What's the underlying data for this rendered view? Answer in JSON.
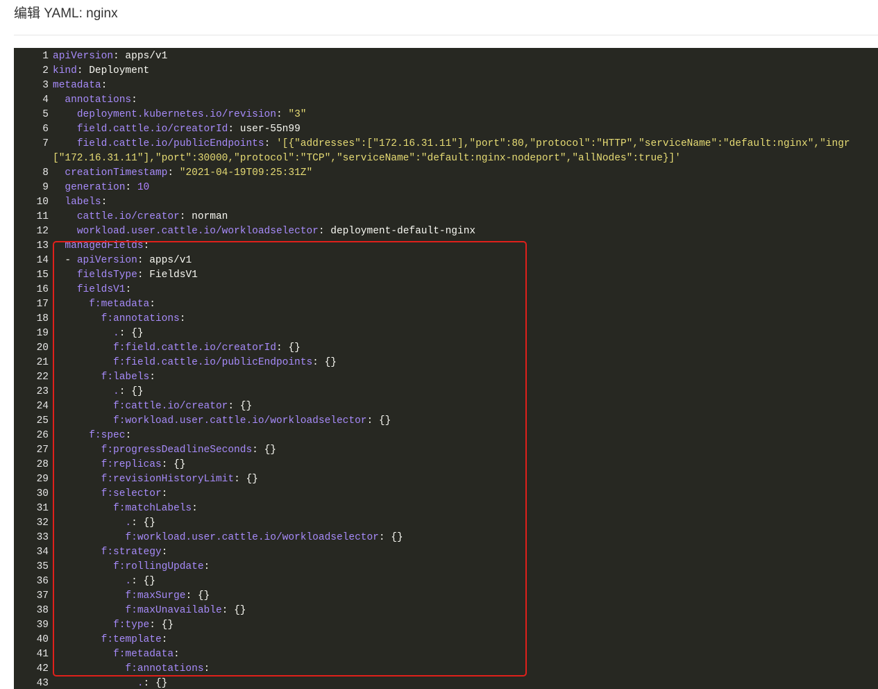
{
  "header": {
    "title": "编辑 YAML: nginx"
  },
  "colors": {
    "editor_bg": "#272822",
    "key": "#a78bfa",
    "string": "#e6db74",
    "highlight_border": "#e0201b"
  },
  "editor": {
    "lines": [
      {
        "n": "1",
        "segs": [
          [
            "k",
            "apiVersion"
          ],
          [
            "p",
            ": "
          ],
          [
            "v",
            "apps/v1"
          ]
        ]
      },
      {
        "n": "2",
        "segs": [
          [
            "k",
            "kind"
          ],
          [
            "p",
            ": "
          ],
          [
            "v",
            "Deployment"
          ]
        ]
      },
      {
        "n": "3",
        "segs": [
          [
            "k",
            "metadata"
          ],
          [
            "p",
            ":"
          ]
        ]
      },
      {
        "n": "4",
        "segs": [
          [
            "v",
            "  "
          ],
          [
            "k",
            "annotations"
          ],
          [
            "p",
            ":"
          ]
        ]
      },
      {
        "n": "5",
        "segs": [
          [
            "v",
            "    "
          ],
          [
            "k",
            "deployment.kubernetes.io/revision"
          ],
          [
            "p",
            ": "
          ],
          [
            "s",
            "\"3\""
          ]
        ]
      },
      {
        "n": "6",
        "segs": [
          [
            "v",
            "    "
          ],
          [
            "k",
            "field.cattle.io/creatorId"
          ],
          [
            "p",
            ": "
          ],
          [
            "v",
            "user-55n99"
          ]
        ]
      },
      {
        "n": "7",
        "segs": [
          [
            "v",
            "    "
          ],
          [
            "k",
            "field.cattle.io/publicEndpoints"
          ],
          [
            "p",
            ": "
          ],
          [
            "s",
            "'[{\"addresses\":[\"172.16.31.11\"],\"port\":80,\"protocol\":\"HTTP\",\"serviceName\":\"default:nginx\",\"ingr"
          ]
        ]
      },
      {
        "n": "",
        "segs": [
          [
            "s",
            "[\"172.16.31.11\"],\"port\":30000,\"protocol\":\"TCP\",\"serviceName\":\"default:nginx-nodeport\",\"allNodes\":true}]'"
          ]
        ]
      },
      {
        "n": "8",
        "segs": [
          [
            "v",
            "  "
          ],
          [
            "k",
            "creationTimestamp"
          ],
          [
            "p",
            ": "
          ],
          [
            "s",
            "\"2021-04-19T09:25:31Z\""
          ]
        ]
      },
      {
        "n": "9",
        "segs": [
          [
            "v",
            "  "
          ],
          [
            "k",
            "generation"
          ],
          [
            "p",
            ": "
          ],
          [
            "n",
            "10"
          ]
        ]
      },
      {
        "n": "10",
        "segs": [
          [
            "v",
            "  "
          ],
          [
            "k",
            "labels"
          ],
          [
            "p",
            ":"
          ]
        ]
      },
      {
        "n": "11",
        "segs": [
          [
            "v",
            "    "
          ],
          [
            "k",
            "cattle.io/creator"
          ],
          [
            "p",
            ": "
          ],
          [
            "v",
            "norman"
          ]
        ]
      },
      {
        "n": "12",
        "segs": [
          [
            "v",
            "    "
          ],
          [
            "k",
            "workload.user.cattle.io/workloadselector"
          ],
          [
            "p",
            ": "
          ],
          [
            "v",
            "deployment-default-nginx"
          ]
        ]
      },
      {
        "n": "13",
        "segs": [
          [
            "v",
            "  "
          ],
          [
            "k",
            "managedFields"
          ],
          [
            "p",
            ":"
          ]
        ]
      },
      {
        "n": "14",
        "segs": [
          [
            "v",
            "  - "
          ],
          [
            "k",
            "apiVersion"
          ],
          [
            "p",
            ": "
          ],
          [
            "v",
            "apps/v1"
          ]
        ]
      },
      {
        "n": "15",
        "segs": [
          [
            "v",
            "    "
          ],
          [
            "k",
            "fieldsType"
          ],
          [
            "p",
            ": "
          ],
          [
            "v",
            "FieldsV1"
          ]
        ]
      },
      {
        "n": "16",
        "segs": [
          [
            "v",
            "    "
          ],
          [
            "k",
            "fieldsV1"
          ],
          [
            "p",
            ":"
          ]
        ]
      },
      {
        "n": "17",
        "segs": [
          [
            "v",
            "      "
          ],
          [
            "k",
            "f:metadata"
          ],
          [
            "p",
            ":"
          ]
        ]
      },
      {
        "n": "18",
        "segs": [
          [
            "v",
            "        "
          ],
          [
            "k",
            "f:annotations"
          ],
          [
            "p",
            ":"
          ]
        ]
      },
      {
        "n": "19",
        "segs": [
          [
            "v",
            "          "
          ],
          [
            "k",
            "."
          ],
          [
            "p",
            ": "
          ],
          [
            "v",
            "{}"
          ]
        ]
      },
      {
        "n": "20",
        "segs": [
          [
            "v",
            "          "
          ],
          [
            "k",
            "f:field.cattle.io/creatorId"
          ],
          [
            "p",
            ": "
          ],
          [
            "v",
            "{}"
          ]
        ]
      },
      {
        "n": "21",
        "segs": [
          [
            "v",
            "          "
          ],
          [
            "k",
            "f:field.cattle.io/publicEndpoints"
          ],
          [
            "p",
            ": "
          ],
          [
            "v",
            "{}"
          ]
        ]
      },
      {
        "n": "22",
        "segs": [
          [
            "v",
            "        "
          ],
          [
            "k",
            "f:labels"
          ],
          [
            "p",
            ":"
          ]
        ]
      },
      {
        "n": "23",
        "segs": [
          [
            "v",
            "          "
          ],
          [
            "k",
            "."
          ],
          [
            "p",
            ": "
          ],
          [
            "v",
            "{}"
          ]
        ]
      },
      {
        "n": "24",
        "segs": [
          [
            "v",
            "          "
          ],
          [
            "k",
            "f:cattle.io/creator"
          ],
          [
            "p",
            ": "
          ],
          [
            "v",
            "{}"
          ]
        ]
      },
      {
        "n": "25",
        "segs": [
          [
            "v",
            "          "
          ],
          [
            "k",
            "f:workload.user.cattle.io/workloadselector"
          ],
          [
            "p",
            ": "
          ],
          [
            "v",
            "{}"
          ]
        ]
      },
      {
        "n": "26",
        "segs": [
          [
            "v",
            "      "
          ],
          [
            "k",
            "f:spec"
          ],
          [
            "p",
            ":"
          ]
        ]
      },
      {
        "n": "27",
        "segs": [
          [
            "v",
            "        "
          ],
          [
            "k",
            "f:progressDeadlineSeconds"
          ],
          [
            "p",
            ": "
          ],
          [
            "v",
            "{}"
          ]
        ]
      },
      {
        "n": "28",
        "segs": [
          [
            "v",
            "        "
          ],
          [
            "k",
            "f:replicas"
          ],
          [
            "p",
            ": "
          ],
          [
            "v",
            "{}"
          ]
        ]
      },
      {
        "n": "29",
        "segs": [
          [
            "v",
            "        "
          ],
          [
            "k",
            "f:revisionHistoryLimit"
          ],
          [
            "p",
            ": "
          ],
          [
            "v",
            "{}"
          ]
        ]
      },
      {
        "n": "30",
        "segs": [
          [
            "v",
            "        "
          ],
          [
            "k",
            "f:selector"
          ],
          [
            "p",
            ":"
          ]
        ]
      },
      {
        "n": "31",
        "segs": [
          [
            "v",
            "          "
          ],
          [
            "k",
            "f:matchLabels"
          ],
          [
            "p",
            ":"
          ]
        ]
      },
      {
        "n": "32",
        "segs": [
          [
            "v",
            "            "
          ],
          [
            "k",
            "."
          ],
          [
            "p",
            ": "
          ],
          [
            "v",
            "{}"
          ]
        ]
      },
      {
        "n": "33",
        "segs": [
          [
            "v",
            "            "
          ],
          [
            "k",
            "f:workload.user.cattle.io/workloadselector"
          ],
          [
            "p",
            ": "
          ],
          [
            "v",
            "{}"
          ]
        ]
      },
      {
        "n": "34",
        "segs": [
          [
            "v",
            "        "
          ],
          [
            "k",
            "f:strategy"
          ],
          [
            "p",
            ":"
          ]
        ]
      },
      {
        "n": "35",
        "segs": [
          [
            "v",
            "          "
          ],
          [
            "k",
            "f:rollingUpdate"
          ],
          [
            "p",
            ":"
          ]
        ]
      },
      {
        "n": "36",
        "segs": [
          [
            "v",
            "            "
          ],
          [
            "k",
            "."
          ],
          [
            "p",
            ": "
          ],
          [
            "v",
            "{}"
          ]
        ]
      },
      {
        "n": "37",
        "segs": [
          [
            "v",
            "            "
          ],
          [
            "k",
            "f:maxSurge"
          ],
          [
            "p",
            ": "
          ],
          [
            "v",
            "{}"
          ]
        ]
      },
      {
        "n": "38",
        "segs": [
          [
            "v",
            "            "
          ],
          [
            "k",
            "f:maxUnavailable"
          ],
          [
            "p",
            ": "
          ],
          [
            "v",
            "{}"
          ]
        ]
      },
      {
        "n": "39",
        "segs": [
          [
            "v",
            "          "
          ],
          [
            "k",
            "f:type"
          ],
          [
            "p",
            ": "
          ],
          [
            "v",
            "{}"
          ]
        ]
      },
      {
        "n": "40",
        "segs": [
          [
            "v",
            "        "
          ],
          [
            "k",
            "f:template"
          ],
          [
            "p",
            ":"
          ]
        ]
      },
      {
        "n": "41",
        "segs": [
          [
            "v",
            "          "
          ],
          [
            "k",
            "f:metadata"
          ],
          [
            "p",
            ":"
          ]
        ]
      },
      {
        "n": "42",
        "segs": [
          [
            "v",
            "            "
          ],
          [
            "k",
            "f:annotations"
          ],
          [
            "p",
            ":"
          ]
        ]
      },
      {
        "n": "43",
        "segs": [
          [
            "v",
            "              "
          ],
          [
            "k",
            "."
          ],
          [
            "p",
            ": "
          ],
          [
            "v",
            "{}"
          ]
        ]
      }
    ]
  }
}
